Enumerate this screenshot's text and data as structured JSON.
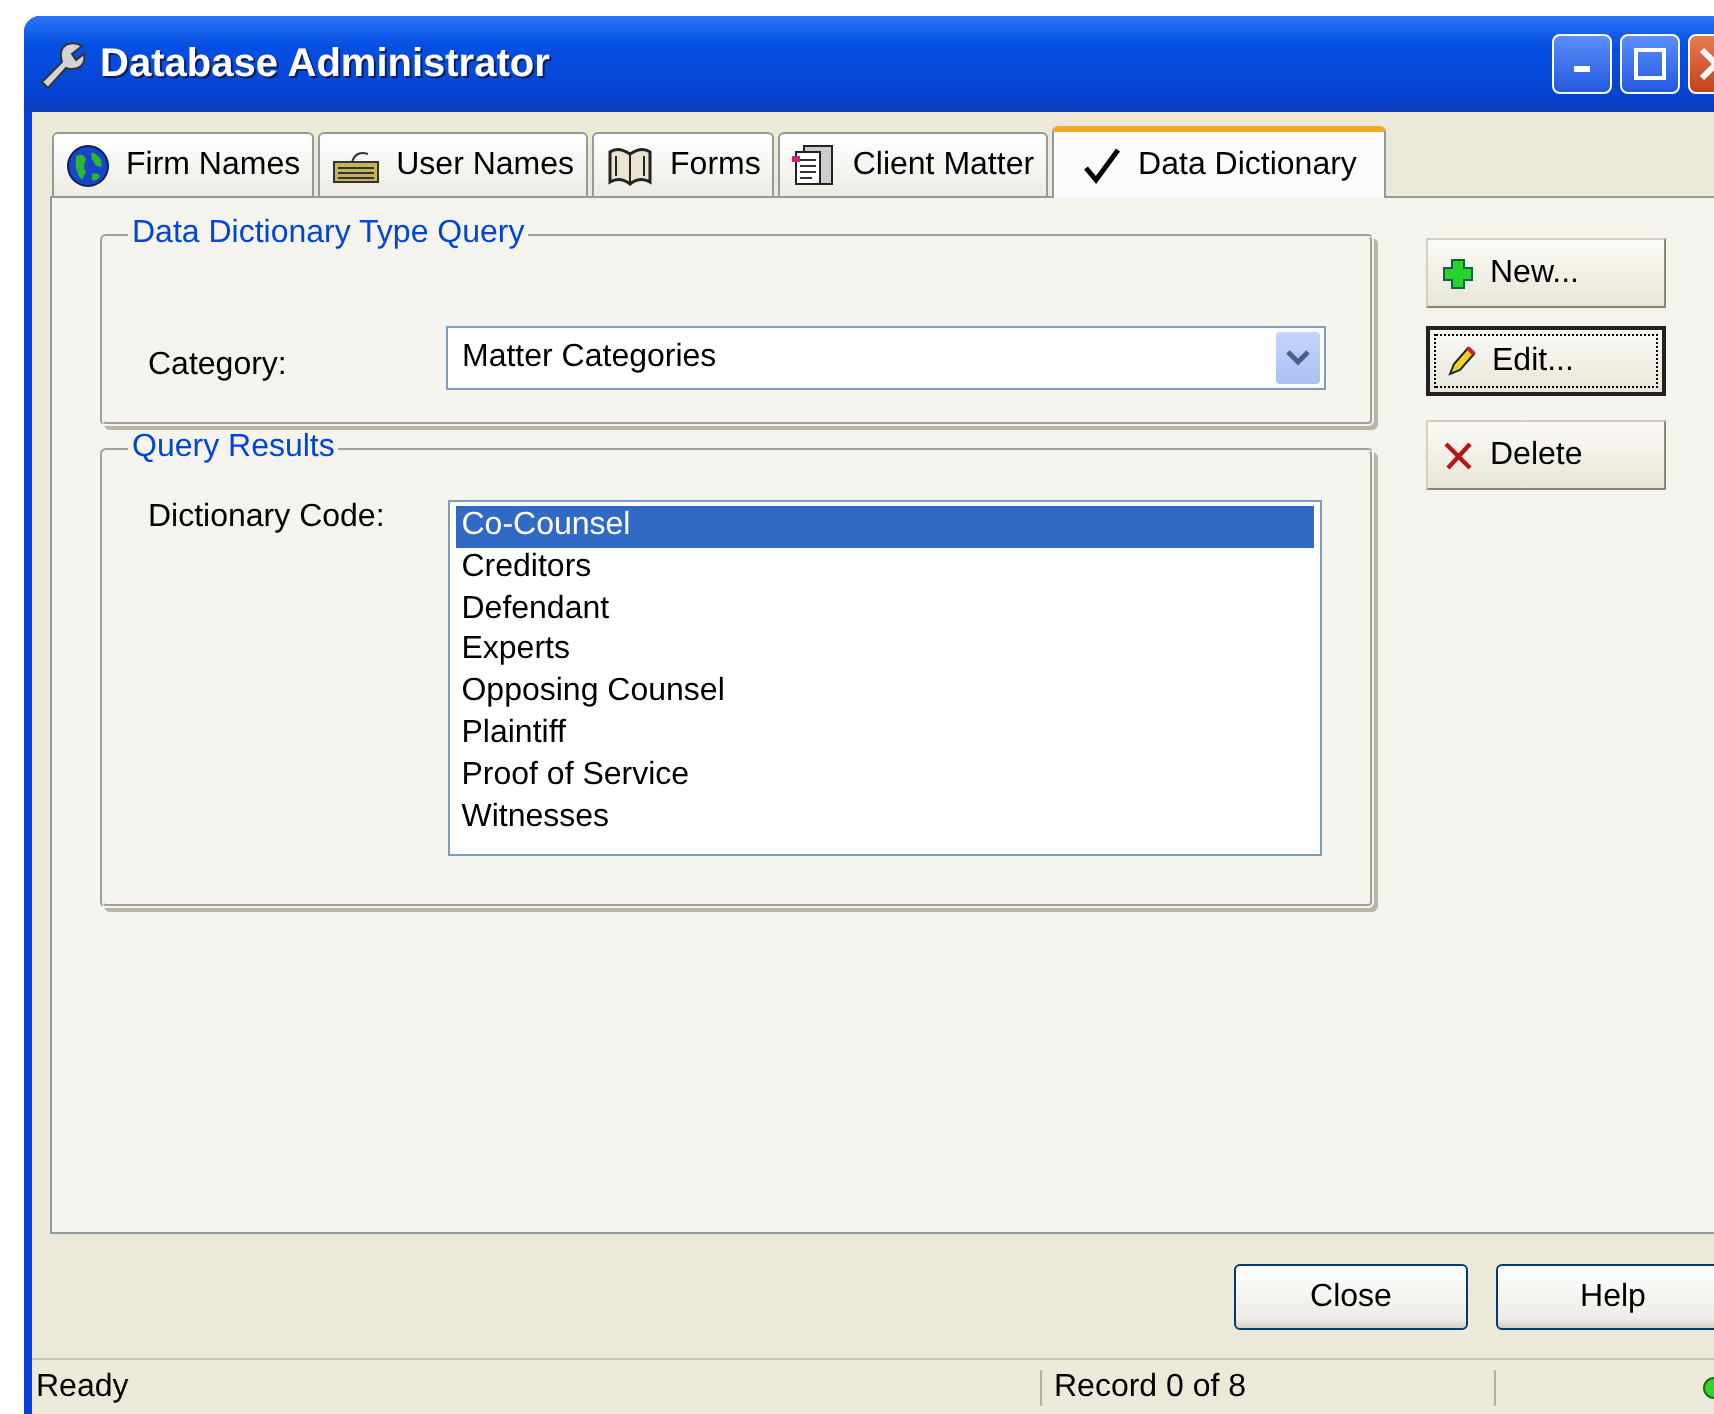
{
  "window": {
    "title": "Database Administrator"
  },
  "tabs": [
    {
      "label": "Firm Names",
      "kind": "globe",
      "selected": false
    },
    {
      "label": "User Names",
      "kind": "keyboard",
      "selected": false
    },
    {
      "label": "Forms",
      "kind": "book",
      "selected": false
    },
    {
      "label": "Client Matter",
      "kind": "document",
      "selected": false
    },
    {
      "label": "Data Dictionary",
      "kind": "check",
      "selected": true
    }
  ],
  "query_group": {
    "title": "Data Dictionary Type Query",
    "category_label": "Category:",
    "category_value": "Matter Categories"
  },
  "results_group": {
    "title": "Query Results",
    "code_label": "Dictionary Code:",
    "items": [
      {
        "label": "Co-Counsel",
        "selected": true
      },
      {
        "label": "Creditors",
        "selected": false
      },
      {
        "label": "Defendant",
        "selected": false
      },
      {
        "label": "Experts",
        "selected": false
      },
      {
        "label": "Opposing Counsel",
        "selected": false
      },
      {
        "label": "Plaintiff",
        "selected": false
      },
      {
        "label": "Proof of Service",
        "selected": false
      },
      {
        "label": "Witnesses",
        "selected": false
      }
    ]
  },
  "side_buttons": [
    {
      "label": "New...",
      "kind": "new",
      "focused": false
    },
    {
      "label": "Edit...",
      "kind": "edit",
      "focused": true
    },
    {
      "label": "Delete",
      "kind": "delete",
      "focused": false
    }
  ],
  "buttons": [
    "Close",
    "Help"
  ],
  "status_bar": {
    "message": "Ready",
    "record": "Record 0 of 8",
    "online": true
  }
}
